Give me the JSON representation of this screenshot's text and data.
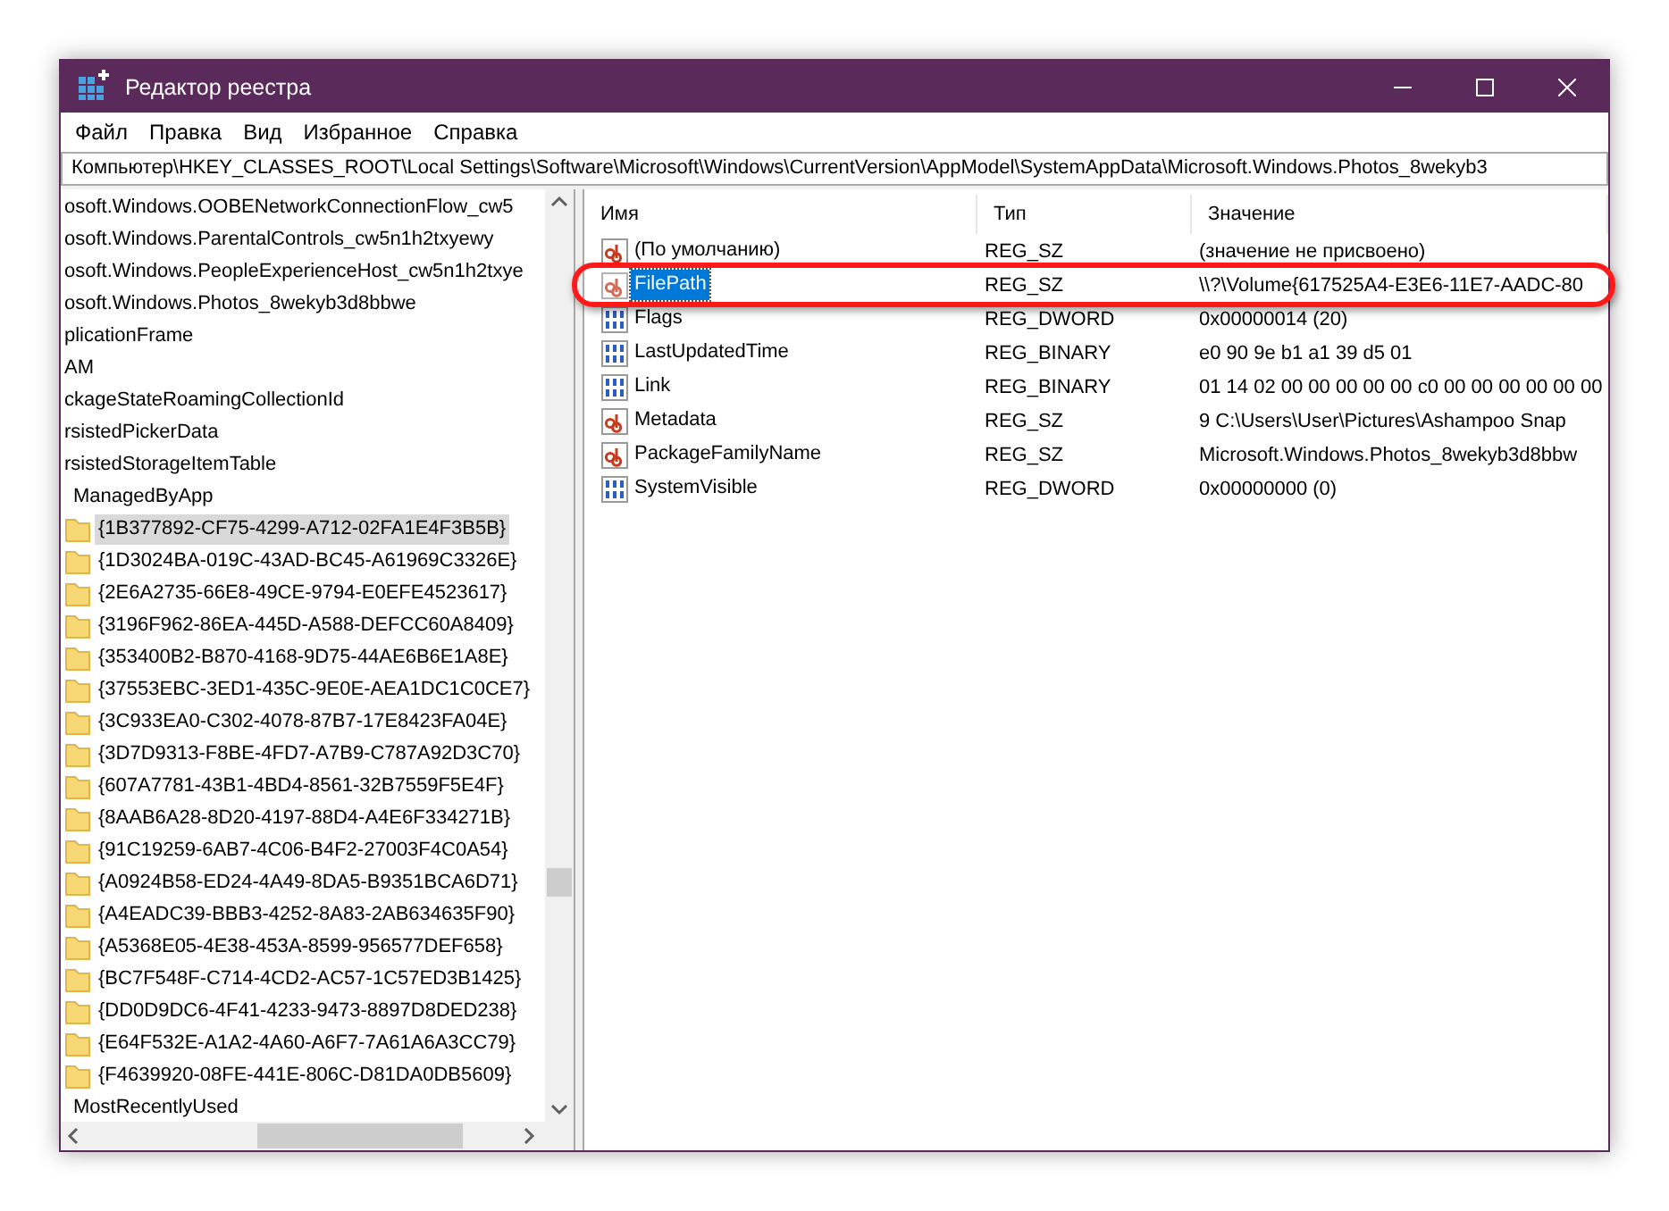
{
  "window": {
    "title": "Редактор реестра"
  },
  "menu": [
    "Файл",
    "Правка",
    "Вид",
    "Избранное",
    "Справка"
  ],
  "address": "Компьютер\\HKEY_CLASSES_ROOT\\Local Settings\\Software\\Microsoft\\Windows\\CurrentVersion\\AppModel\\SystemAppData\\Microsoft.Windows.Photos_8wekyb3",
  "tree": [
    {
      "label": "osoft.Windows.OOBENetworkConnectionFlow_cw5",
      "selected": false
    },
    {
      "label": "osoft.Windows.ParentalControls_cw5n1h2txyewy",
      "selected": false
    },
    {
      "label": "osoft.Windows.PeopleExperienceHost_cw5n1h2txye",
      "selected": false
    },
    {
      "label": "osoft.Windows.Photos_8wekyb3d8bbwe",
      "selected": false
    },
    {
      "label": "plicationFrame",
      "selected": false
    },
    {
      "label": "AM",
      "selected": false
    },
    {
      "label": "ckageStateRoamingCollectionId",
      "selected": false
    },
    {
      "label": "rsistedPickerData",
      "selected": false
    },
    {
      "label": "rsistedStorageItemTable",
      "selected": false,
      "children": [
        {
          "label": "ManagedByApp",
          "selected": false,
          "children": [
            {
              "label": "{1B377892-CF75-4299-A712-02FA1E4F3B5B}",
              "selected": true
            },
            {
              "label": "{1D3024BA-019C-43AD-BC45-A61969C3326E}",
              "selected": false
            },
            {
              "label": "{2E6A2735-66E8-49CE-9794-E0EFE4523617}",
              "selected": false
            },
            {
              "label": "{3196F962-86EA-445D-A588-DEFCC60A8409}",
              "selected": false
            },
            {
              "label": "{353400B2-B870-4168-9D75-44AE6B6E1A8E}",
              "selected": false
            },
            {
              "label": "{37553EBC-3ED1-435C-9E0E-AEA1DC1C0CE7}",
              "selected": false
            },
            {
              "label": "{3C933EA0-C302-4078-87B7-17E8423FA04E}",
              "selected": false
            },
            {
              "label": "{3D7D9313-F8BE-4FD7-A7B9-C787A92D3C70}",
              "selected": false
            },
            {
              "label": "{607A7781-43B1-4BD4-8561-32B7559F5E4F}",
              "selected": false
            },
            {
              "label": "{8AAB6A28-8D20-4197-88D4-A4E6F334271B}",
              "selected": false
            },
            {
              "label": "{91C19259-6AB7-4C06-B4F2-27003F4C0A54}",
              "selected": false
            },
            {
              "label": "{A0924B58-ED24-4A49-8DA5-B9351BCA6D71}",
              "selected": false
            },
            {
              "label": "{A4EADC39-BBB3-4252-8A83-2AB634635F90}",
              "selected": false
            },
            {
              "label": "{A5368E05-4E38-453A-8599-956577DEF658}",
              "selected": false
            },
            {
              "label": "{BC7F548F-C714-4CD2-AC57-1C57ED3B1425}",
              "selected": false
            },
            {
              "label": "{DD0D9DC6-4F41-4233-9473-8897D8DED238}",
              "selected": false
            },
            {
              "label": "{E64F532E-A1A2-4A60-A6F7-7A61A6A3CC79}",
              "selected": false
            },
            {
              "label": "{F4639920-08FE-441E-806C-D81DA0DB5609}",
              "selected": false
            }
          ]
        },
        {
          "label": "MostRecentlyUsed",
          "selected": false
        }
      ]
    }
  ],
  "columns": [
    "Имя",
    "Тип",
    "Значение"
  ],
  "rows": [
    {
      "kind": "string",
      "name": "(По умолчанию)",
      "type": "REG_SZ",
      "value": "(значение не присвоено)",
      "selected": false
    },
    {
      "kind": "string",
      "name": "FilePath",
      "type": "REG_SZ",
      "value": "\\\\?\\Volume{617525A4-E3E6-11E7-AADC-80",
      "selected": true
    },
    {
      "kind": "binary",
      "name": "Flags",
      "type": "REG_DWORD",
      "value": "0x00000014 (20)",
      "selected": false
    },
    {
      "kind": "binary",
      "name": "LastUpdatedTime",
      "type": "REG_BINARY",
      "value": "e0 90 9e b1 a1 39 d5 01",
      "selected": false
    },
    {
      "kind": "binary",
      "name": "Link",
      "type": "REG_BINARY",
      "value": "01 14 02 00 00 00 00 00 c0 00 00 00 00 00 00",
      "selected": false
    },
    {
      "kind": "string",
      "name": "Metadata",
      "type": "REG_SZ",
      "value": "9 C:\\Users\\User\\Pictures\\Ashampoo Snap",
      "selected": false
    },
    {
      "kind": "string",
      "name": "PackageFamilyName",
      "type": "REG_SZ",
      "value": "Microsoft.Windows.Photos_8wekyb3d8bbw",
      "selected": false
    },
    {
      "kind": "binary",
      "name": "SystemVisible",
      "type": "REG_DWORD",
      "value": "0x00000000 (0)",
      "selected": false
    }
  ]
}
